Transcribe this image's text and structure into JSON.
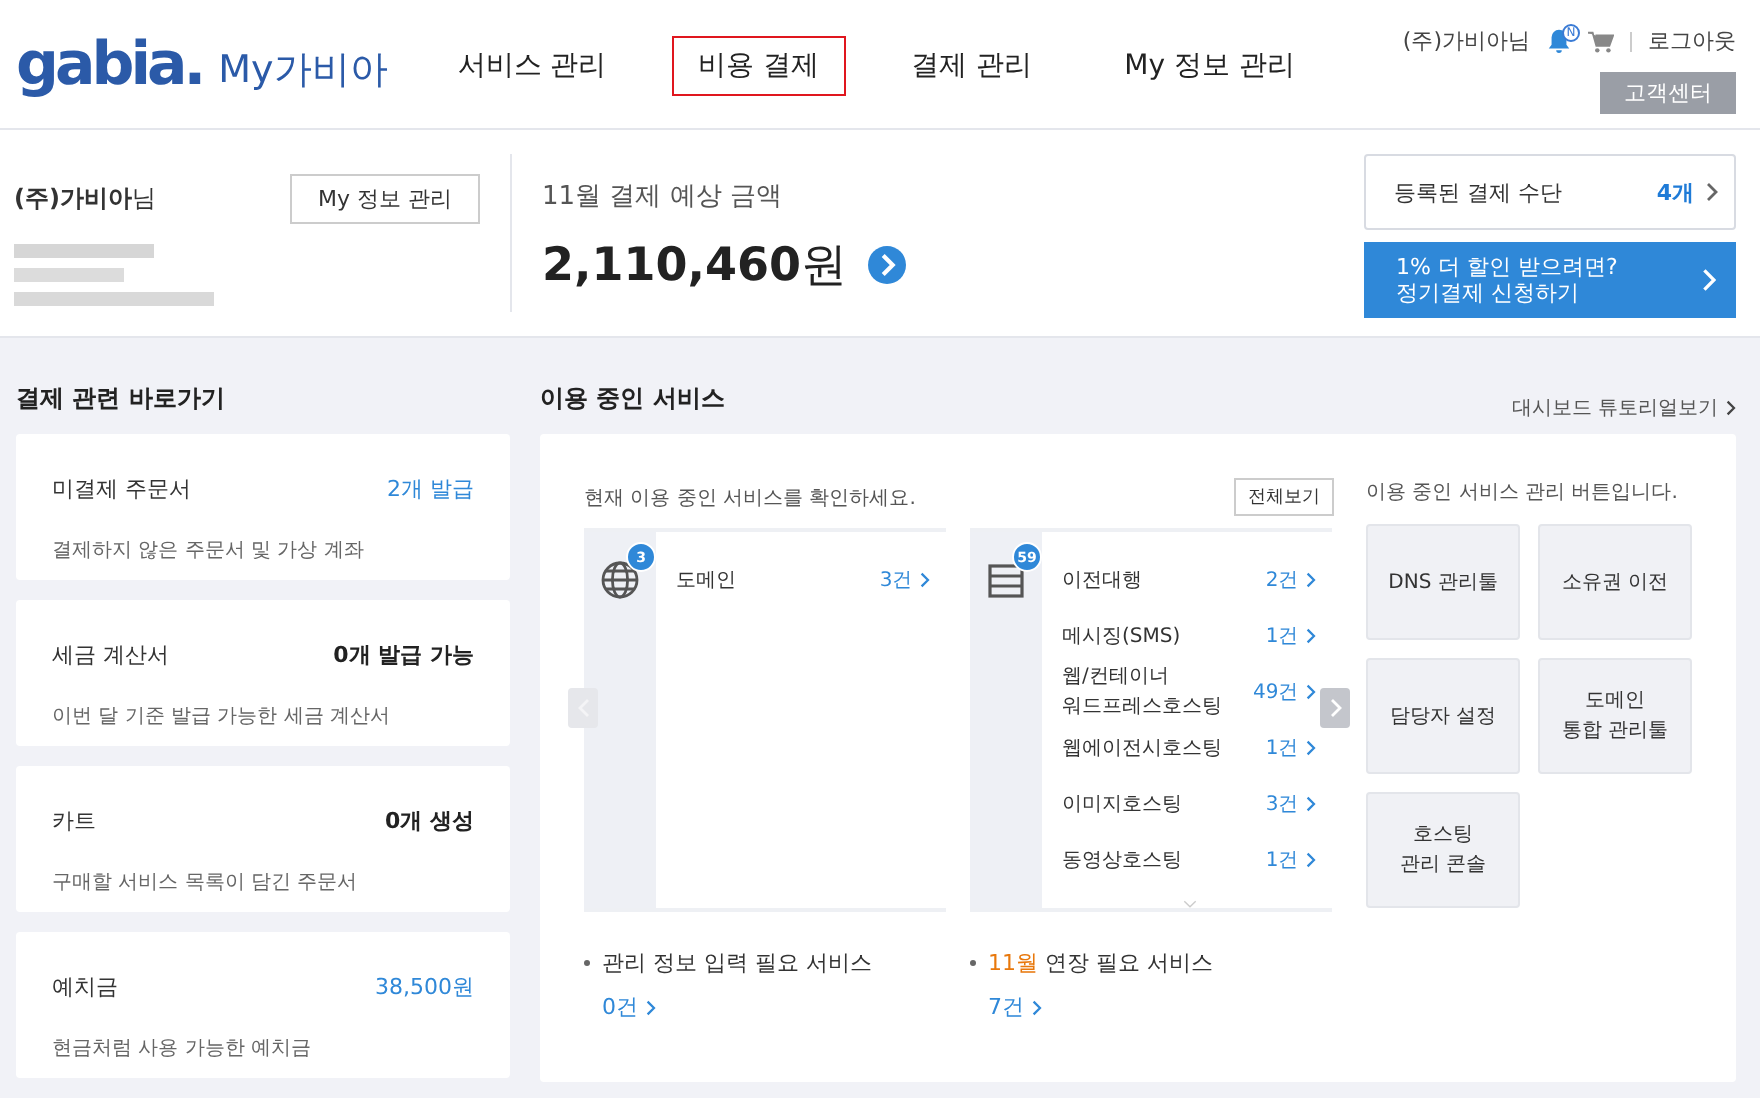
{
  "header": {
    "logo": "gabia.",
    "product": "My가비아",
    "nav": [
      {
        "label": "서비스 관리",
        "selected": false
      },
      {
        "label": "비용 결제",
        "selected": true
      },
      {
        "label": "결제 관리",
        "selected": false
      },
      {
        "label": "My 정보 관리",
        "selected": false
      }
    ],
    "user": "(주)가비아님",
    "notification_badge": "N",
    "logout": "로그아웃",
    "support": "고객센터"
  },
  "account": {
    "name": "**(주)가비아**님",
    "profile_button": "My 정보 관리"
  },
  "estimate": {
    "title": "11월 결제 예상 금액",
    "amount": "2,110,460",
    "unit": "원"
  },
  "payment_methods": {
    "label": "등록된 결제 수단",
    "count": "4개"
  },
  "promo": {
    "line1": "1% 더 할인 받으려면?",
    "line2": "정기결제 신청하기"
  },
  "shortcuts": {
    "title": "결제 관련 바로가기",
    "items": [
      {
        "title": "미결제 주문서",
        "value": "2개 발급",
        "kind": "link",
        "description": "결제하지 않은 주문서 및 가상 계좌"
      },
      {
        "title": "세금 계산서",
        "value": "0개 발급 가능",
        "kind": "count",
        "description": "이번 달 기준 발급 가능한 세금 계산서"
      },
      {
        "title": "카트",
        "value": "0개 생성",
        "kind": "count",
        "description": "구매할 서비스 목록이 담긴 주문서"
      },
      {
        "title": "예치금",
        "value": "38,500원",
        "kind": "link",
        "description": "현금처럼 사용 가능한 예치금"
      }
    ]
  },
  "services": {
    "title": "이용 중인 서비스",
    "tutorial_link": "대시보드 튜토리얼보기",
    "intro": "현재 이용 중인 서비스를 확인하세요.",
    "view_all": "전체보기",
    "prev_disabled": true,
    "cards": [
      {
        "kind": "domain",
        "badge": "3",
        "items": [
          {
            "name": "도메인",
            "count": "3건"
          }
        ]
      },
      {
        "kind": "hosting",
        "badge": "59",
        "more": true,
        "items": [
          {
            "name": "이전대행",
            "count": "2건"
          },
          {
            "name": "메시징(SMS)",
            "count": "1건"
          },
          {
            "name": "웹/컨테이너\n워드프레스호스팅",
            "count": "49건"
          },
          {
            "name": "웹에이전시호스팅",
            "count": "1건"
          },
          {
            "name": "이미지호스팅",
            "count": "3건"
          },
          {
            "name": "동영상호스팅",
            "count": "1건"
          }
        ]
      }
    ],
    "notices": [
      {
        "label": "관리 정보 입력 필요 서비스",
        "count": "0건"
      },
      {
        "month": "11월",
        "label": "연장 필요 서비스",
        "count": "7건"
      }
    ],
    "tools_intro": "이용 중인 서비스 관리 버튼입니다.",
    "tool_rows": [
      [
        "DNS 관리툴",
        "소유권 이전"
      ],
      [
        "담당자 설정",
        "도메인\n통합 관리툴"
      ],
      [
        "호스팅\n관리 콘솔"
      ]
    ]
  }
}
